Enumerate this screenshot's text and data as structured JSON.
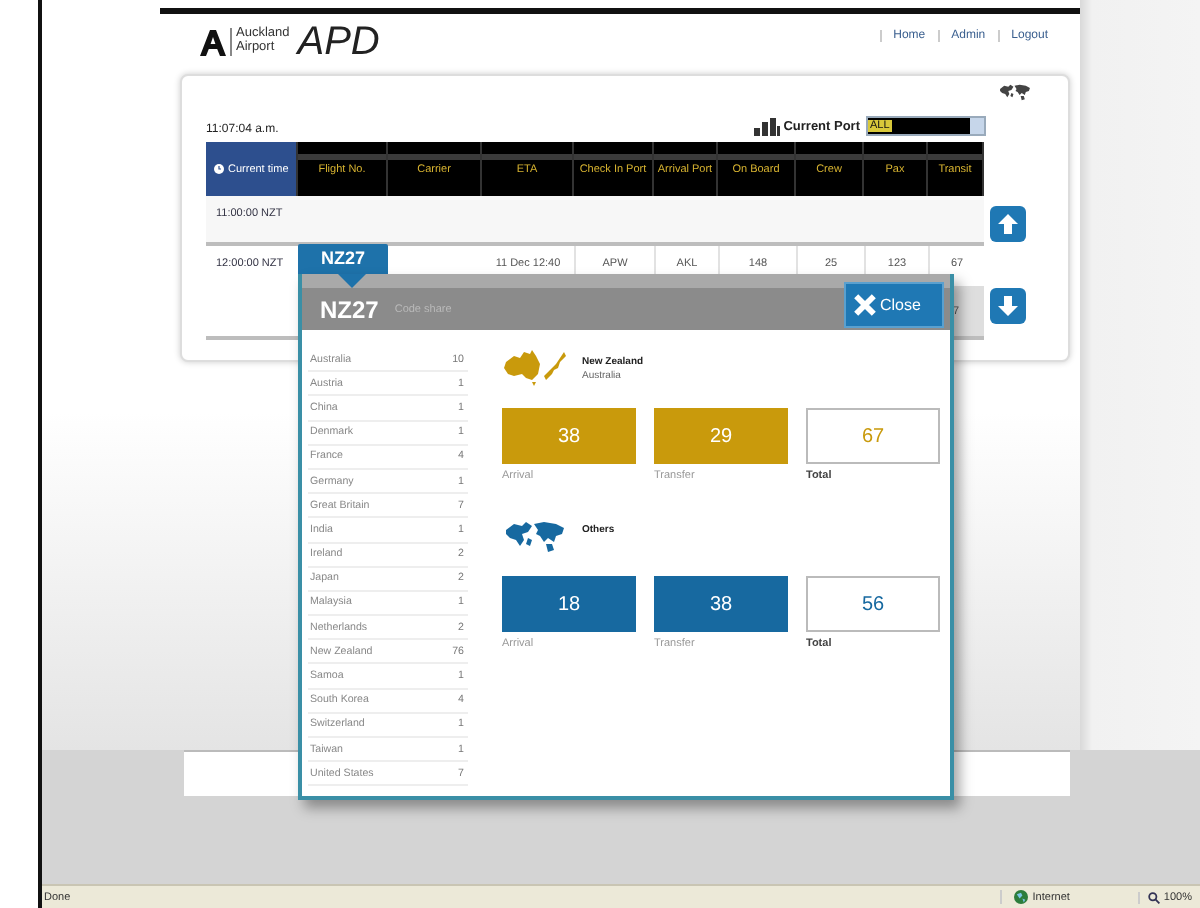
{
  "header": {
    "logo_line1": "Auckland",
    "logo_line2": "Airport",
    "app_name": "APD",
    "links": [
      "Home",
      "Admin",
      "Logout"
    ]
  },
  "toolbar": {
    "clock": "11:07:04 a.m.",
    "port_label": "Current Port",
    "port_value": "ALL"
  },
  "table": {
    "columns": [
      {
        "label": "Current time",
        "kind": "time"
      },
      {
        "label": "Flight No.",
        "kind": "data"
      },
      {
        "label": "Carrier",
        "kind": "data"
      },
      {
        "label": "ETA",
        "kind": "data"
      },
      {
        "label": "Check In Port",
        "kind": "data"
      },
      {
        "label": "Arrival Port",
        "kind": "data"
      },
      {
        "label": "On Board",
        "kind": "data"
      },
      {
        "label": "Crew",
        "kind": "data"
      },
      {
        "label": "Pax",
        "kind": "data"
      },
      {
        "label": "Transit",
        "kind": "data"
      }
    ],
    "rows": [
      {
        "time": "11:00:00 NZT"
      },
      {
        "time": "12:00:00 NZT",
        "flight": "NZ27",
        "values": [
          "11 Dec 12:40",
          "APW",
          "AKL",
          "148",
          "25",
          "123",
          "67"
        ],
        "second_line_transit": "7"
      }
    ]
  },
  "popup": {
    "flight": "NZ27",
    "subtitle": "Code share",
    "close": "Close",
    "countries": [
      {
        "name": "Australia",
        "count": "10"
      },
      {
        "name": "Austria",
        "count": "1"
      },
      {
        "name": "China",
        "count": "1"
      },
      {
        "name": "Denmark",
        "count": "1"
      },
      {
        "name": "France",
        "count": "4"
      },
      {
        "name": "Germany",
        "count": "1"
      },
      {
        "name": "Great Britain",
        "count": "7"
      },
      {
        "name": "India",
        "count": "1"
      },
      {
        "name": "Ireland",
        "count": "2"
      },
      {
        "name": "Japan",
        "count": "2"
      },
      {
        "name": "Malaysia",
        "count": "1"
      },
      {
        "name": "Netherlands",
        "count": "2"
      },
      {
        "name": "New Zealand",
        "count": "76"
      },
      {
        "name": "Samoa",
        "count": "1"
      },
      {
        "name": "South Korea",
        "count": "4"
      },
      {
        "name": "Switzerland",
        "count": "1"
      },
      {
        "name": "Taiwan",
        "count": "1"
      },
      {
        "name": "United States",
        "count": "7"
      }
    ],
    "groups": [
      {
        "kind": "oceania",
        "color": "#c99a0c",
        "title_lines": [
          "New Zealand",
          "Australia"
        ],
        "stats": [
          {
            "kind": "filled",
            "value": "38",
            "label": "Arrival"
          },
          {
            "kind": "filled",
            "value": "29",
            "label": "Transfer"
          },
          {
            "kind": "total",
            "value": "67",
            "label": "Total"
          }
        ]
      },
      {
        "kind": "world",
        "color": "#1769a0",
        "title_lines": [
          "Others"
        ],
        "stats": [
          {
            "kind": "filled",
            "value": "18",
            "label": "Arrival"
          },
          {
            "kind": "filled",
            "value": "38",
            "label": "Transfer"
          },
          {
            "kind": "total",
            "value": "56",
            "label": "Total"
          }
        ]
      }
    ]
  },
  "status_bar": {
    "status": "Done",
    "zone": "Internet",
    "zoom": "100%"
  }
}
